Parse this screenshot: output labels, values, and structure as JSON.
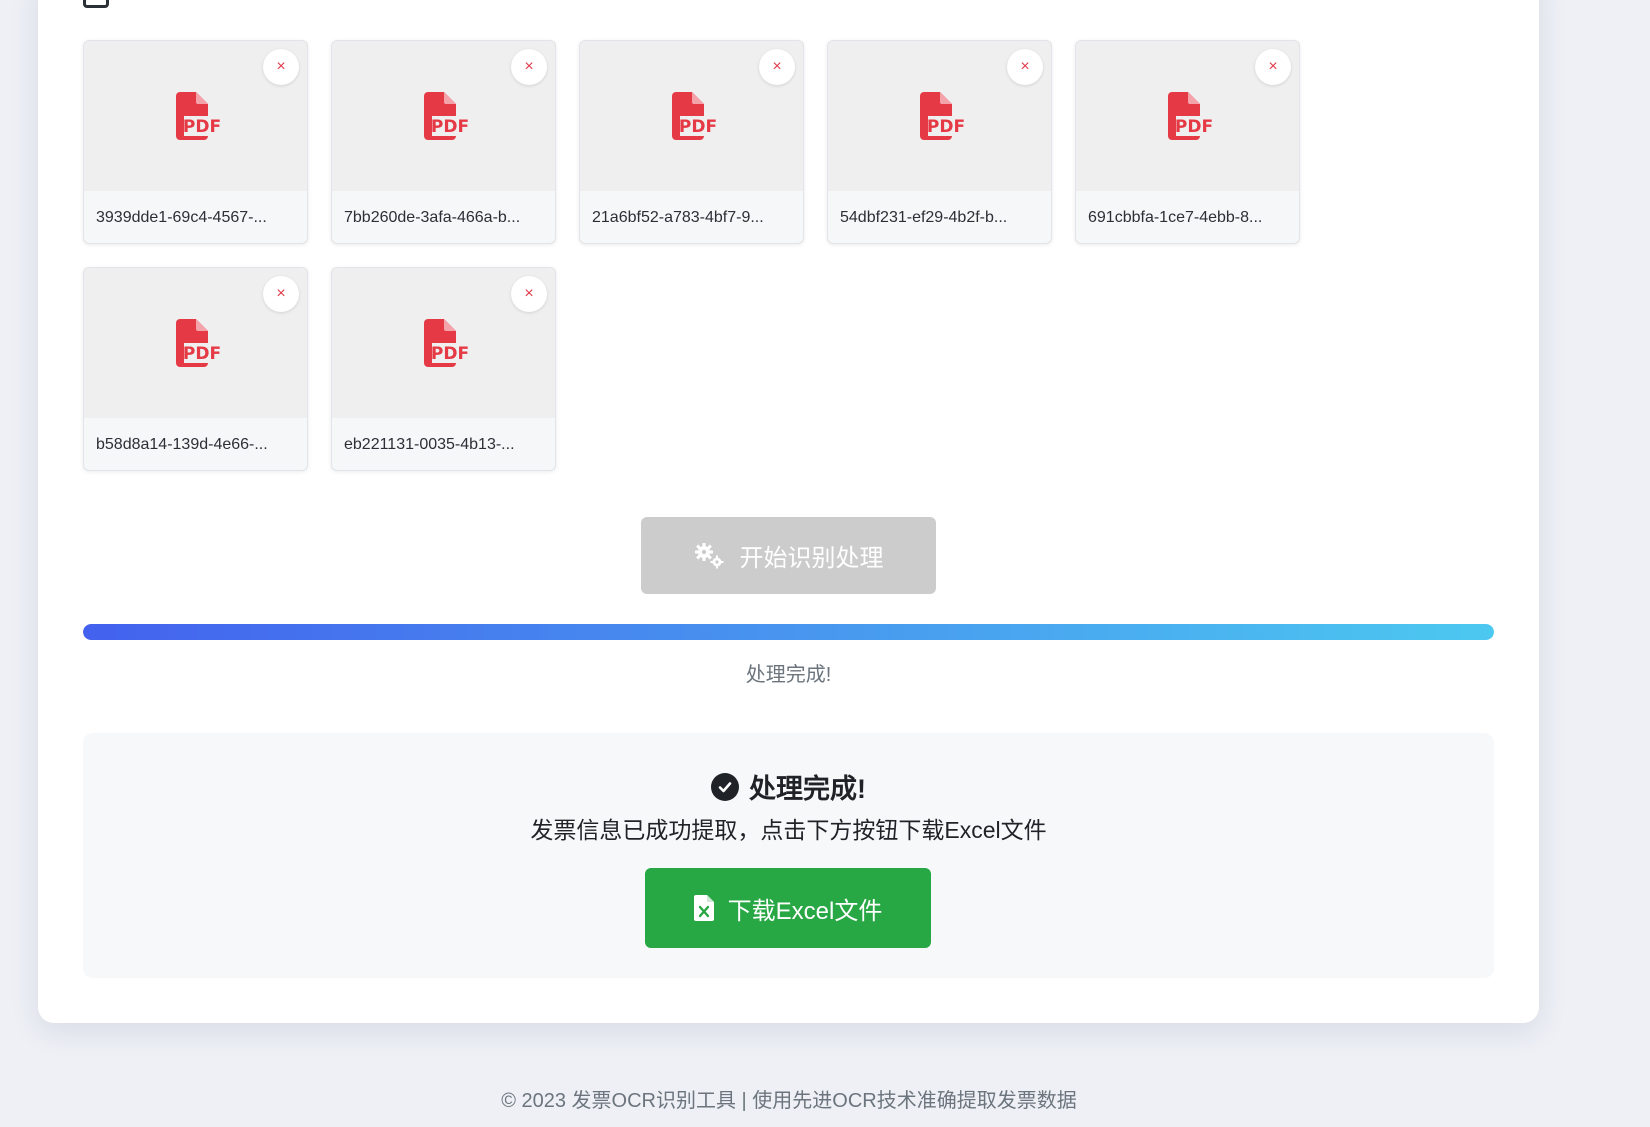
{
  "colors": {
    "pdf_red": "#e63946",
    "remove_red": "#e03a4a",
    "disabled_gray": "#cccccc",
    "success_green": "#28a745",
    "progress_start": "#4361ee",
    "progress_end": "#4cc9f0"
  },
  "files": [
    {
      "name": "3939dde1-69c4-4567-...",
      "icon": "pdf-icon",
      "remove_label": "×"
    },
    {
      "name": "7bb260de-3afa-466a-b...",
      "icon": "pdf-icon",
      "remove_label": "×"
    },
    {
      "name": "21a6bf52-a783-4bf7-9...",
      "icon": "pdf-icon",
      "remove_label": "×"
    },
    {
      "name": "54dbf231-ef29-4b2f-b...",
      "icon": "pdf-icon",
      "remove_label": "×"
    },
    {
      "name": "691cbbfa-1ce7-4ebb-8...",
      "icon": "pdf-icon",
      "remove_label": "×"
    },
    {
      "name": "b58d8a14-139d-4e66-...",
      "icon": "pdf-icon",
      "remove_label": "×"
    },
    {
      "name": "eb221131-0035-4b13-...",
      "icon": "pdf-icon",
      "remove_label": "×"
    }
  ],
  "pdf_badge_text": "PDF",
  "process_button": {
    "label": "开始识别处理",
    "icon": "gears-icon",
    "disabled": true
  },
  "progress": {
    "percent": 100,
    "status": "处理完成!"
  },
  "result": {
    "title": "处理完成!",
    "title_icon": "check-circle-icon",
    "description": "发票信息已成功提取，点击下方按钮下载Excel文件",
    "download_label": "下载Excel文件",
    "download_icon": "excel-file-icon"
  },
  "footer": {
    "text": "© 2023 发票OCR识别工具 | 使用先进OCR技术准确提取发票数据"
  }
}
